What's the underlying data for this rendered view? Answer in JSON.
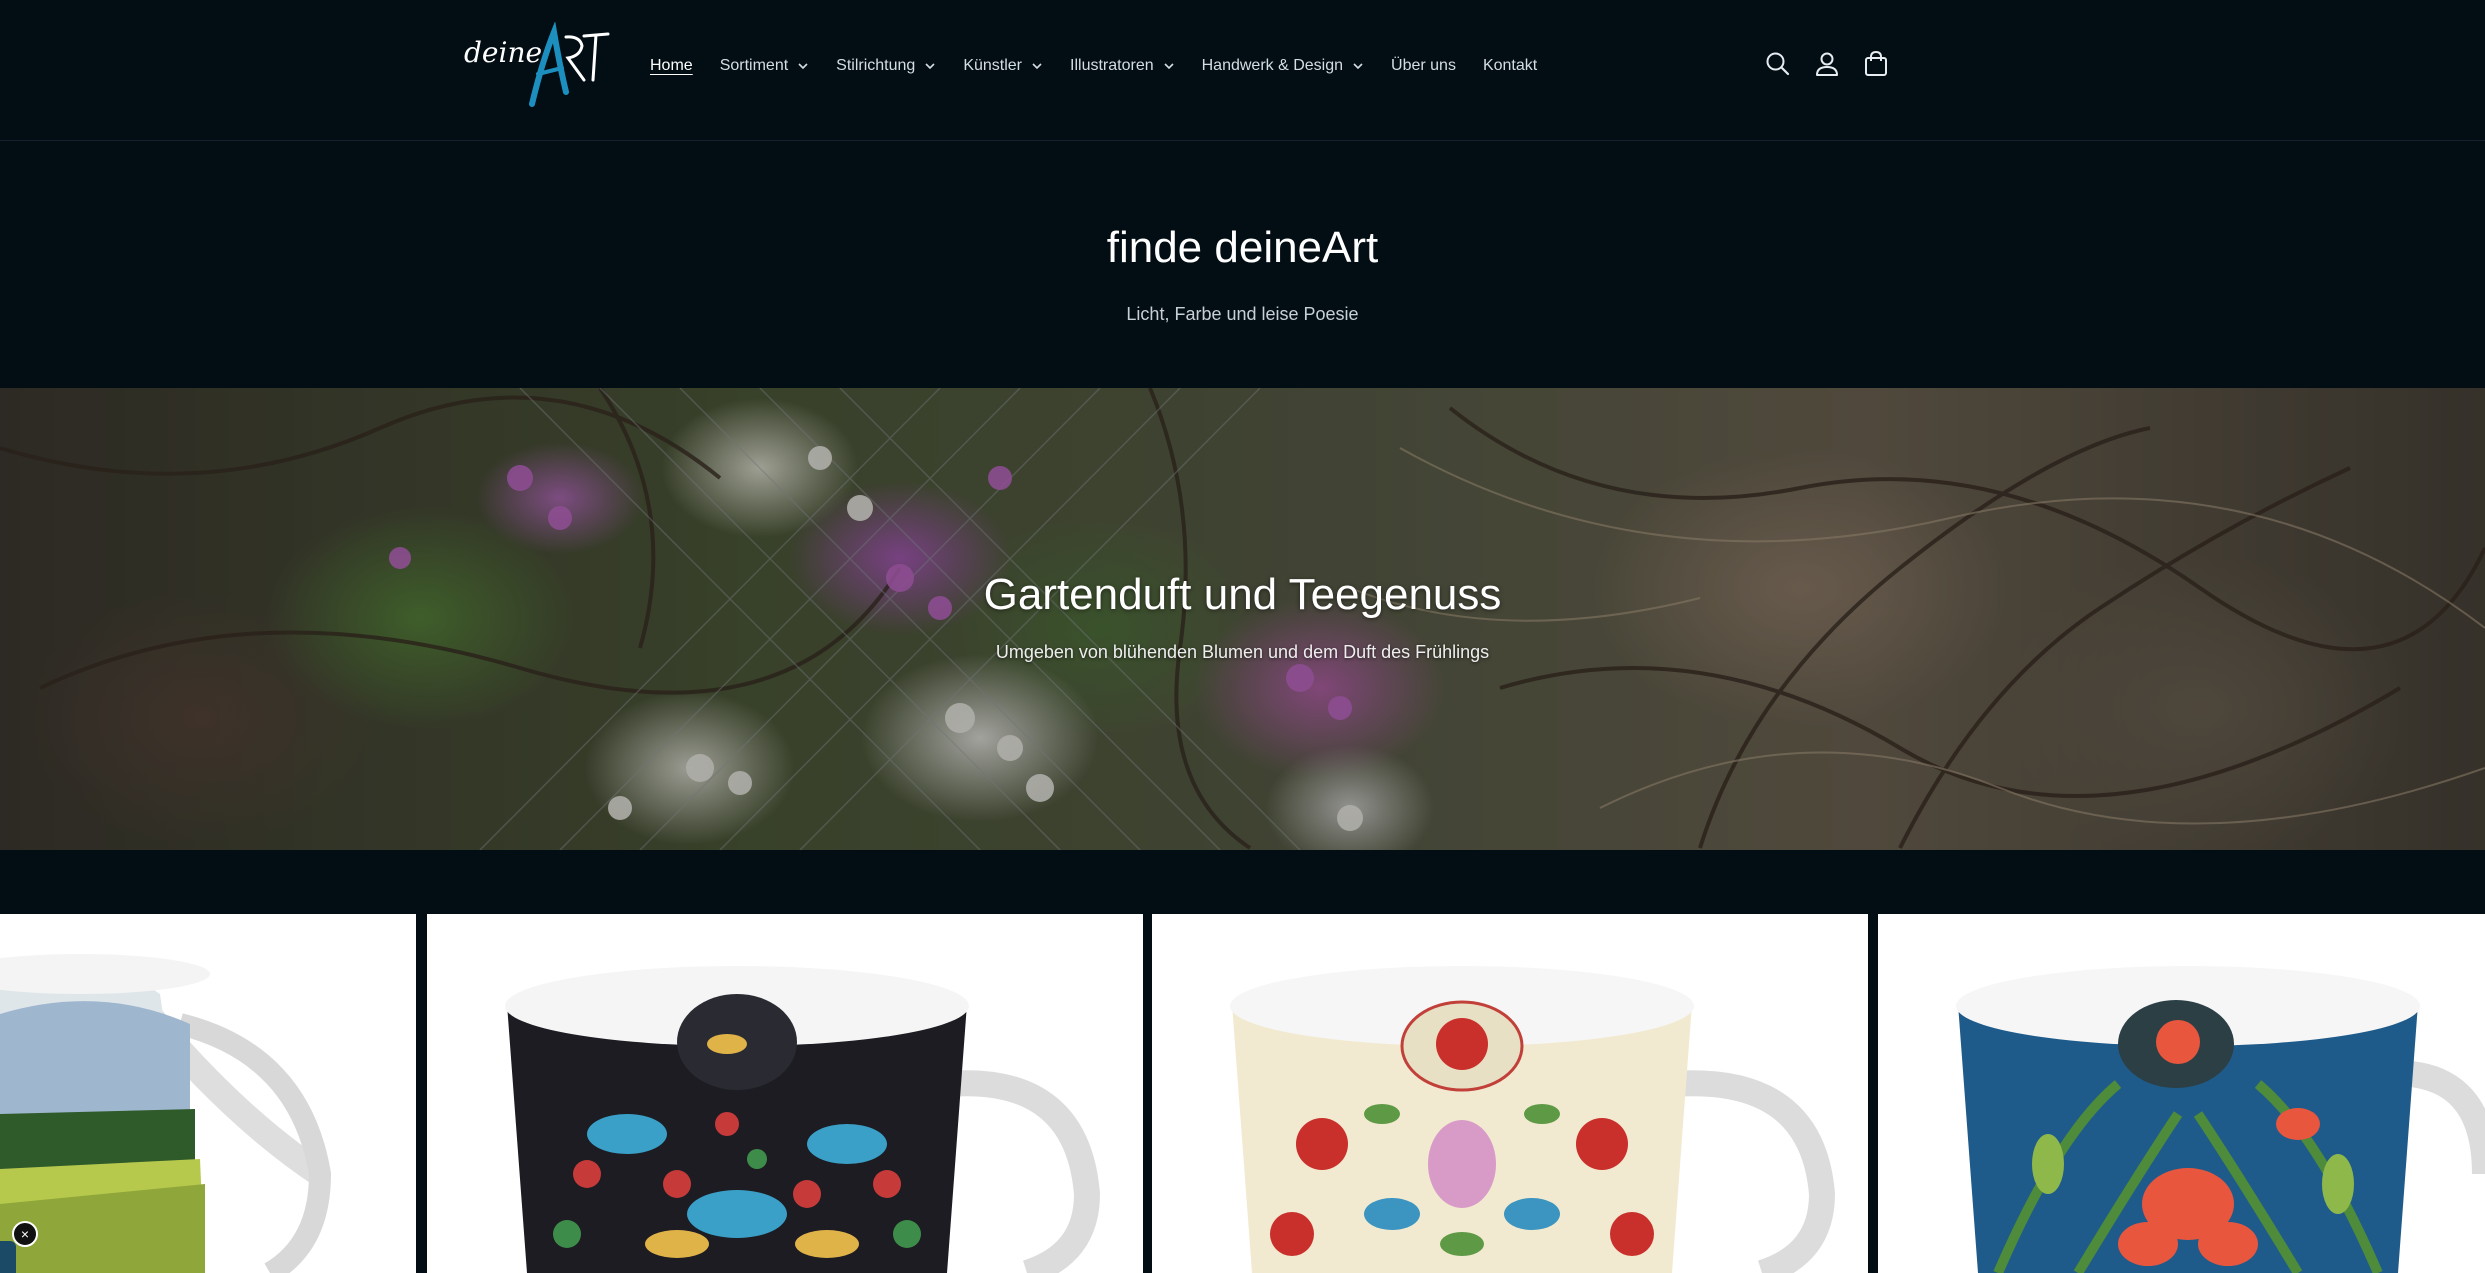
{
  "brand": {
    "logo_text_1": "deine",
    "logo_text_2": "ART"
  },
  "nav": {
    "items": [
      {
        "label": "Home",
        "active": true,
        "dropdown": false
      },
      {
        "label": "Sortiment",
        "dropdown": true
      },
      {
        "label": "Stilrichtung",
        "dropdown": true
      },
      {
        "label": "Künstler",
        "dropdown": true
      },
      {
        "label": "Illustratoren",
        "dropdown": true
      },
      {
        "label": "Handwerk & Design",
        "dropdown": true
      },
      {
        "label": "Über uns",
        "dropdown": false
      },
      {
        "label": "Kontakt",
        "dropdown": false
      }
    ]
  },
  "header_icons": [
    "search-icon",
    "account-icon",
    "cart-icon"
  ],
  "intro": {
    "title": "finde deineArt",
    "subtitle": "Licht, Farbe und leise Poesie"
  },
  "banner": {
    "title": "Gartenduft und Teegenuss",
    "subtitle": "Umgeben von blühenden Blumen und dem Duft des Frühlings"
  },
  "colors": {
    "background": "#020d14",
    "accent": "#1c7fb0",
    "text": "#ffffff"
  },
  "products": [
    {
      "pattern": "landscape"
    },
    {
      "pattern": "strawberry-thief"
    },
    {
      "pattern": "rose-tulip"
    },
    {
      "pattern": "red-iris"
    }
  ]
}
